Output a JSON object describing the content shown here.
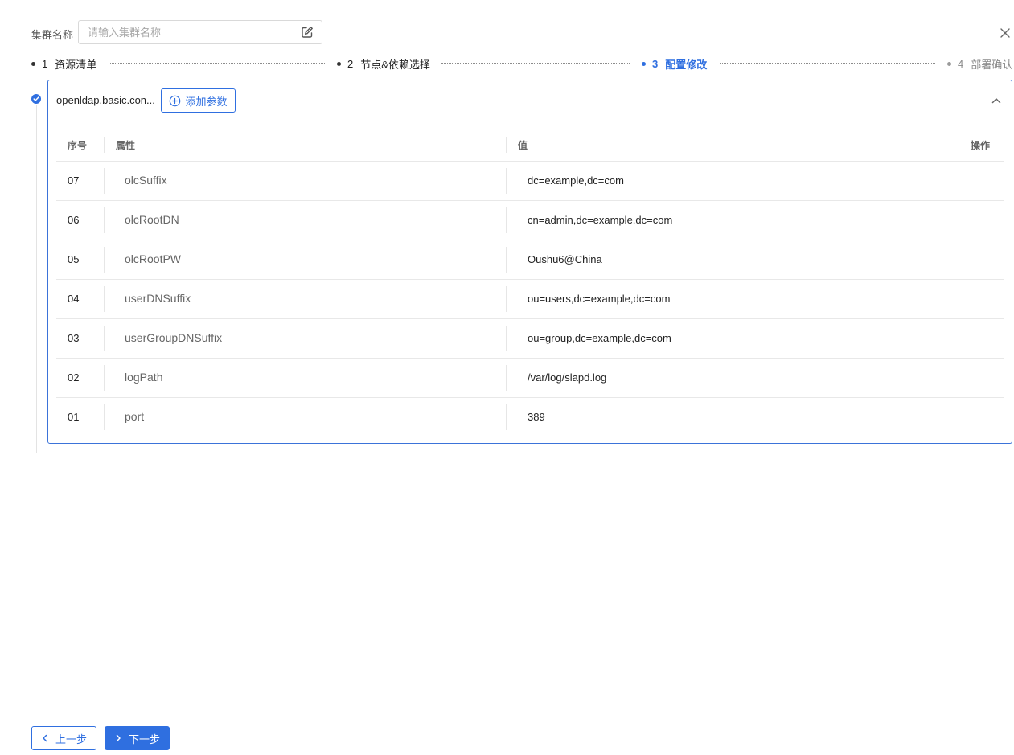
{
  "header": {
    "name_label": "集群名称",
    "name_placeholder": "请输入集群名称",
    "name_value": ""
  },
  "steps": [
    {
      "num": "1",
      "label": "资源清单",
      "state": "done"
    },
    {
      "num": "2",
      "label": "节点&依赖选择",
      "state": "done"
    },
    {
      "num": "3",
      "label": "配置修改",
      "state": "active"
    },
    {
      "num": "4",
      "label": "部署确认",
      "state": "pending"
    }
  ],
  "panel": {
    "title": "openldap.basic.con...",
    "add_button_label": "添加参数",
    "table": {
      "headers": {
        "seq": "序号",
        "attr": "属性",
        "value": "值",
        "ops": "操作"
      },
      "rows": [
        {
          "seq": "07",
          "attr": "olcSuffix",
          "value": "dc=example,dc=com"
        },
        {
          "seq": "06",
          "attr": "olcRootDN",
          "value": "cn=admin,dc=example,dc=com"
        },
        {
          "seq": "05",
          "attr": "olcRootPW",
          "value": "Oushu6@China"
        },
        {
          "seq": "04",
          "attr": "userDNSuffix",
          "value": "ou=users,dc=example,dc=com"
        },
        {
          "seq": "03",
          "attr": "userGroupDNSuffix",
          "value": "ou=group,dc=example,dc=com"
        },
        {
          "seq": "02",
          "attr": "logPath",
          "value": "/var/log/slapd.log"
        },
        {
          "seq": "01",
          "attr": "port",
          "value": "389"
        }
      ]
    }
  },
  "footer": {
    "prev_label": "上一步",
    "next_label": "下一步"
  },
  "colors": {
    "accent": "#2f6fe0",
    "border": "#e8e8e8",
    "muted_text": "#666666"
  }
}
